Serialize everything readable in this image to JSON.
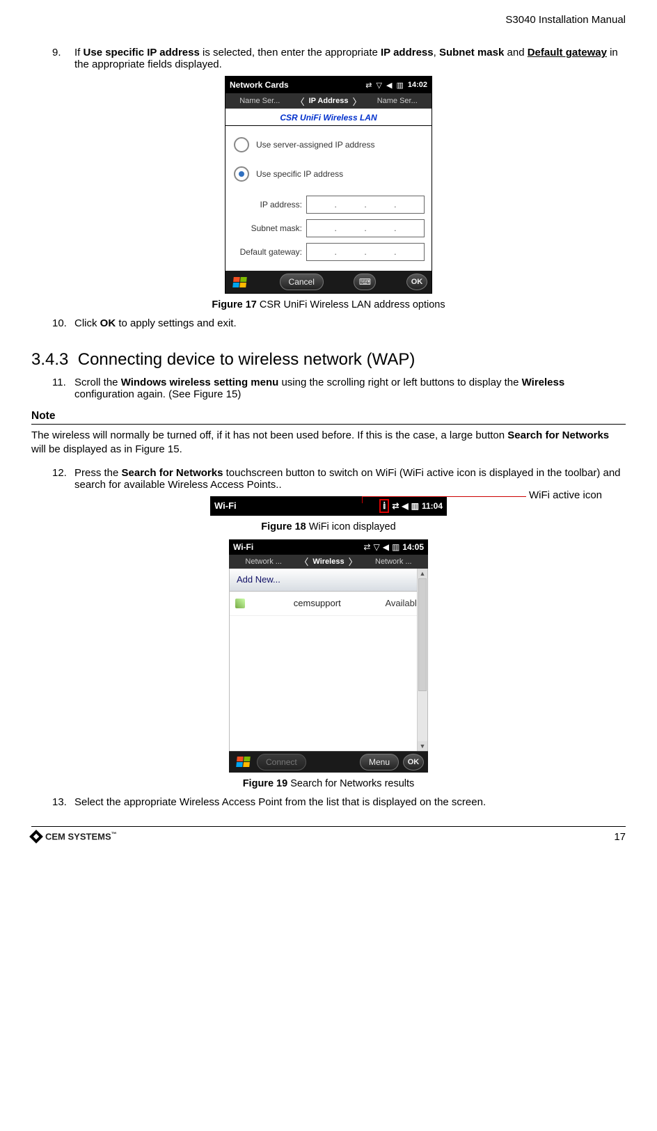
{
  "header": {
    "doc_title": "S3040 Installation Manual"
  },
  "steps": {
    "s9": {
      "num": "9.",
      "t1": "If ",
      "b1": "Use specific IP address",
      "t2": " is selected, then enter the appropriate ",
      "b2": "IP address",
      "t3": ", ",
      "b3": "Subnet mask",
      "t4": " and ",
      "b4": "Default gateway",
      "t5": " in the appropriate fields displayed."
    },
    "s10": {
      "num": "10.",
      "t1": "Click ",
      "b1": "OK",
      "t2": " to apply settings and exit."
    },
    "s11": {
      "num": "11.",
      "t1": "Scroll the ",
      "b1": "Windows wireless setting menu",
      "t2": " using the scrolling right or left buttons to display the ",
      "b2": "Wireless",
      "t3": " configuration again. (See Figure 15)"
    },
    "s12": {
      "num": "12.",
      "t1": "Press the ",
      "b1": "Search for Networks",
      "t2": " touchscreen button to switch on WiFi (WiFi active icon is displayed in the toolbar) and search for available Wireless Access Points.."
    },
    "s13": {
      "num": "13.",
      "t1": "Select the appropriate Wireless Access Point from the list that is displayed on the screen."
    }
  },
  "section": {
    "num": "3.4.3",
    "title": "Connecting device to wireless network (WAP)"
  },
  "note": {
    "header": "Note",
    "t1": "The wireless will normally be turned off, if it has not been used before. If this is the case, a large button ",
    "b1": "Search for Networks",
    "t2": " will be displayed as in Figure 15."
  },
  "fig17": {
    "caption_bold": "Figure 17 ",
    "caption_rest": "CSR UniFi Wireless LAN address options",
    "top_title": "Network Cards",
    "clock": "14:02",
    "tab_left": "Name Ser...",
    "tab_mid": "IP Address",
    "tab_right": "Name Ser...",
    "subtitle": "CSR UniFi Wireless LAN",
    "radio1": "Use server-assigned IP address",
    "radio2": "Use specific IP address",
    "lbl_ip": "IP address:",
    "lbl_mask": "Subnet mask:",
    "lbl_gw": "Default gateway:",
    "dots": ".",
    "cancel": "Cancel",
    "ok": "OK"
  },
  "fig18": {
    "caption_bold": "Figure 18 ",
    "caption_rest": "WiFi icon displayed",
    "title": "Wi-Fi",
    "clock": "11:04",
    "callout": "WiFi active icon"
  },
  "fig19": {
    "caption_bold": "Figure 19 ",
    "caption_rest": "Search for Networks results",
    "top_title": "Wi-Fi",
    "clock": "14:05",
    "tab_left": "Network ...",
    "tab_mid": "Wireless",
    "tab_right": "Network ...",
    "addnew": "Add New...",
    "net_name": "cemsupport",
    "net_status": "Available",
    "connect": "Connect",
    "menu": "Menu",
    "ok": "OK"
  },
  "footer": {
    "brand": "CEM SYSTEMS",
    "page": "17"
  }
}
